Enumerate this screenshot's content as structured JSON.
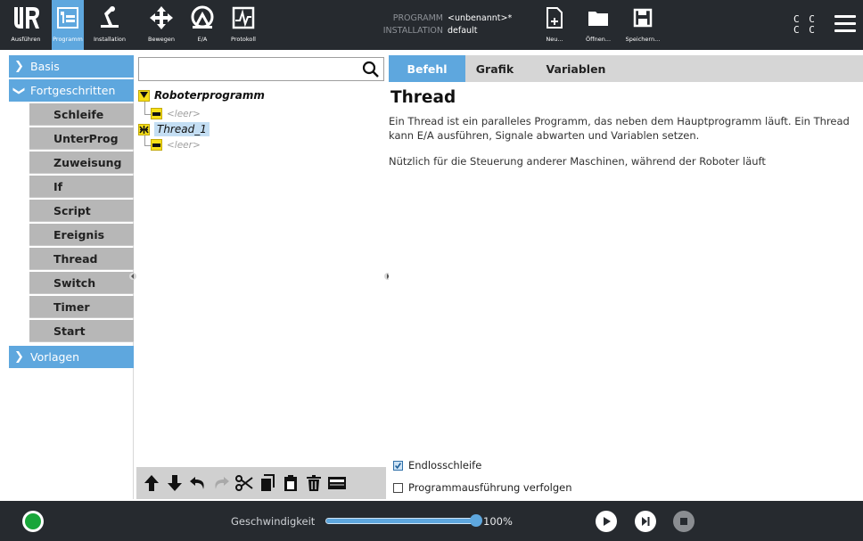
{
  "topbar": {
    "nav": [
      {
        "label": "Ausführen",
        "icon": "ur-logo-icon"
      },
      {
        "label": "Programm",
        "icon": "program-tree-icon",
        "active": true
      },
      {
        "label": "Installation",
        "icon": "robot-arm-icon"
      },
      {
        "label": "Bewegen",
        "icon": "move-arrows-icon"
      },
      {
        "label": "E/A",
        "icon": "io-gauge-icon"
      },
      {
        "label": "Protokoll",
        "icon": "log-icon"
      }
    ],
    "program_key": "PROGRAMM",
    "program_value": "<unbenannt>*",
    "installation_key": "INSTALLATION",
    "installation_value": "default",
    "file_buttons": [
      {
        "label": "Neu...",
        "icon": "new-file-icon"
      },
      {
        "label": "Öffnen...",
        "icon": "open-folder-icon"
      },
      {
        "label": "Speichern...",
        "icon": "save-disk-icon"
      }
    ],
    "cc_lines": [
      "C C",
      "C C"
    ],
    "menu_icon": "hamburger-menu-icon",
    "accent_color": "#5ea7de",
    "background_color": "#262a2f"
  },
  "left_panel": {
    "categories": [
      {
        "label": "Basis",
        "expanded": false
      },
      {
        "label": "Fortgeschritten",
        "expanded": true
      },
      {
        "label": "Vorlagen",
        "expanded": false
      }
    ],
    "commands": [
      "Schleife",
      "UnterProg",
      "Zuweisung",
      "If",
      "Script",
      "Ereignis",
      "Thread",
      "Switch",
      "Timer",
      "Start"
    ]
  },
  "tree": {
    "search_placeholder": "",
    "root_label": "Roboterprogramm",
    "empty_label": "<leer>",
    "thread_label": "Thread_1",
    "toolbar_icons": [
      "move-up-icon",
      "move-down-icon",
      "undo-icon",
      "redo-icon",
      "cut-icon",
      "copy-icon",
      "paste-icon",
      "delete-icon",
      "suppress-icon"
    ]
  },
  "right_panel": {
    "tabs": [
      "Befehl",
      "Grafik",
      "Variablen"
    ],
    "active_tab": "Befehl",
    "title": "Thread",
    "description_1": "Ein Thread ist ein paralleles Programm, das neben dem Hauptprogramm läuft. Ein Thread kann E/A ausführen, Signale abwarten und Variablen setzen.",
    "description_2": "Nützlich für die Steuerung anderer Maschinen, während der Roboter läuft",
    "checkboxes": [
      {
        "label": "Endlosschleife",
        "checked": true
      },
      {
        "label": "Programmausführung verfolgen",
        "checked": false
      }
    ]
  },
  "footer": {
    "speed_label": "Geschwindigkeit",
    "speed_percent": 100,
    "speed_value": "100%",
    "power_status_color": "#19a63a",
    "controls": [
      "play-icon",
      "step-icon",
      "stop-icon"
    ]
  }
}
